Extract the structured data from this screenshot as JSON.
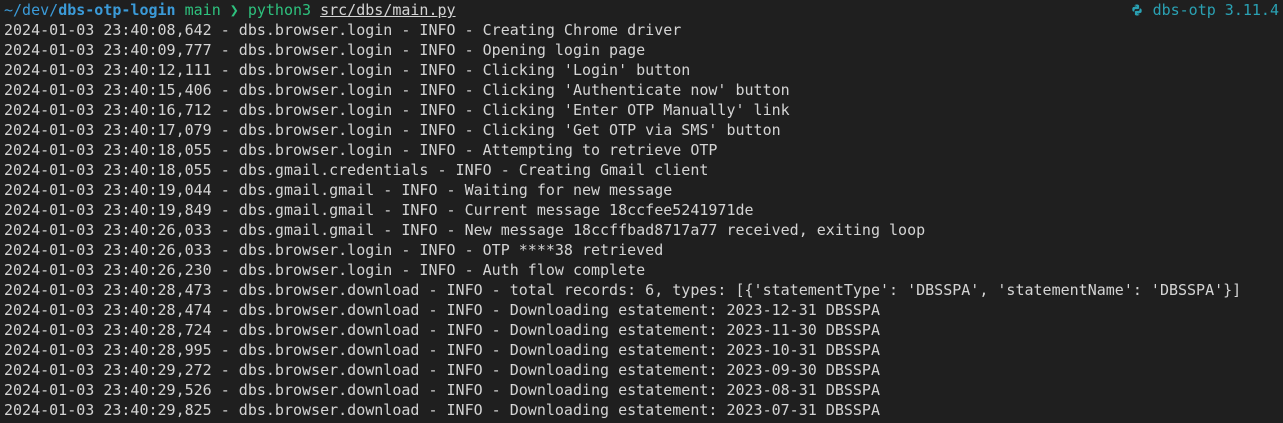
{
  "prompt": {
    "path_prefix": "~/dev/",
    "repo": "dbs-otp-login",
    "branch": "main",
    "chevron": "❯",
    "command": "python3",
    "argument": "src/dbs/main.py",
    "env_icon": "python-icon",
    "env_label": "dbs-otp 3.11.4"
  },
  "colors": {
    "background": "#1f1f1f",
    "text": "#d4d4d4",
    "path": "#3b9bd9",
    "branch": "#2ec27e",
    "env": "#2aa1b3"
  },
  "log_lines": [
    "2024-01-03 23:40:08,642 - dbs.browser.login - INFO - Creating Chrome driver",
    "2024-01-03 23:40:09,777 - dbs.browser.login - INFO - Opening login page",
    "2024-01-03 23:40:12,111 - dbs.browser.login - INFO - Clicking 'Login' button",
    "2024-01-03 23:40:15,406 - dbs.browser.login - INFO - Clicking 'Authenticate now' button",
    "2024-01-03 23:40:16,712 - dbs.browser.login - INFO - Clicking 'Enter OTP Manually' link",
    "2024-01-03 23:40:17,079 - dbs.browser.login - INFO - Clicking 'Get OTP via SMS' button",
    "2024-01-03 23:40:18,055 - dbs.browser.login - INFO - Attempting to retrieve OTP",
    "2024-01-03 23:40:18,055 - dbs.gmail.credentials - INFO - Creating Gmail client",
    "2024-01-03 23:40:19,044 - dbs.gmail.gmail - INFO - Waiting for new message",
    "2024-01-03 23:40:19,849 - dbs.gmail.gmail - INFO - Current message 18ccfee5241971de",
    "2024-01-03 23:40:26,033 - dbs.gmail.gmail - INFO - New message 18ccffbad8717a77 received, exiting loop",
    "2024-01-03 23:40:26,033 - dbs.browser.login - INFO - OTP ****38 retrieved",
    "2024-01-03 23:40:26,230 - dbs.browser.login - INFO - Auth flow complete",
    "2024-01-03 23:40:28,473 - dbs.browser.download - INFO - total records: 6, types: [{'statementType': 'DBSSPA', 'statementName': 'DBSSPA'}]",
    "2024-01-03 23:40:28,474 - dbs.browser.download - INFO - Downloading estatement: 2023-12-31 DBSSPA",
    "2024-01-03 23:40:28,724 - dbs.browser.download - INFO - Downloading estatement: 2023-11-30 DBSSPA",
    "2024-01-03 23:40:28,995 - dbs.browser.download - INFO - Downloading estatement: 2023-10-31 DBSSPA",
    "2024-01-03 23:40:29,272 - dbs.browser.download - INFO - Downloading estatement: 2023-09-30 DBSSPA",
    "2024-01-03 23:40:29,526 - dbs.browser.download - INFO - Downloading estatement: 2023-08-31 DBSSPA",
    "2024-01-03 23:40:29,825 - dbs.browser.download - INFO - Downloading estatement: 2023-07-31 DBSSPA"
  ]
}
